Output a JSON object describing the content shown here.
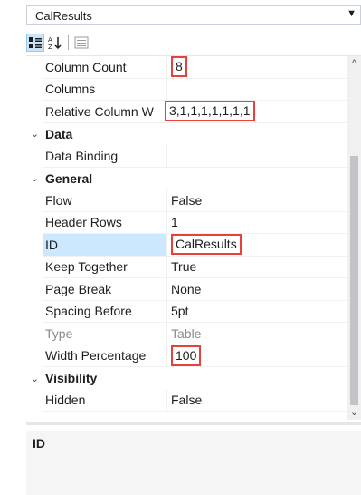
{
  "object_selector": {
    "value": "CalResults"
  },
  "toolbar": {
    "categorized_icon": "categorized-icon",
    "alphabetical_icon": "alphabetical-icon",
    "property_pages_icon": "property-pages-icon"
  },
  "rows": [
    {
      "name": "Column Count",
      "value": "8",
      "highlight": true
    },
    {
      "name": "Columns",
      "value": ""
    },
    {
      "name": "Relative Column W",
      "value": "3,1,1,1,1,1,1,1",
      "highlight": true
    },
    {
      "category": true,
      "name": "Data"
    },
    {
      "name": "Data Binding",
      "value": ""
    },
    {
      "category": true,
      "name": "General"
    },
    {
      "name": "Flow",
      "value": "False"
    },
    {
      "name": "Header Rows",
      "value": "1"
    },
    {
      "name": "ID",
      "value": "CalResults",
      "highlight": true,
      "selected": true
    },
    {
      "name": "Keep Together",
      "value": "True"
    },
    {
      "name": "Page Break",
      "value": "None"
    },
    {
      "name": "Spacing Before",
      "value": "5pt"
    },
    {
      "name": "Type",
      "value": "Table",
      "readonly": true
    },
    {
      "name": "Width Percentage",
      "value": "100",
      "highlight": true
    },
    {
      "category": true,
      "name": "Visibility"
    },
    {
      "name": "Hidden",
      "value": "False"
    }
  ],
  "description": {
    "title": "ID"
  },
  "colors": {
    "highlight_border": "#e8403a",
    "selected_bg": "#cce8ff"
  }
}
